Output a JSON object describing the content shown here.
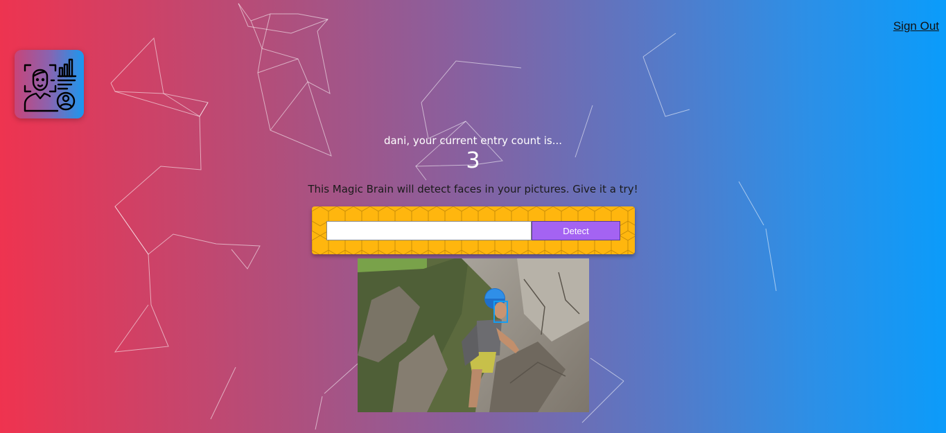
{
  "header": {
    "sign_out_label": "Sign Out"
  },
  "logo": {
    "icon": "face-recognition-icon"
  },
  "rank": {
    "entry_text": "dani, your current entry count is...",
    "entry_count": "3"
  },
  "intro": {
    "text": "This Magic Brain will detect faces in your pictures. Give it a try!"
  },
  "image_link_form": {
    "input_value": "",
    "input_placeholder": "",
    "detect_label": "Detect"
  },
  "face_recognition": {
    "image_description_icon": "rock-climber-photo",
    "faces_detected": 1
  },
  "colors": {
    "gradient_left": "#ef334f",
    "gradient_right": "#0a9cfb",
    "form_panel": "#ffb60e",
    "detect_button": "#a463f2",
    "face_box": "#149df2"
  }
}
